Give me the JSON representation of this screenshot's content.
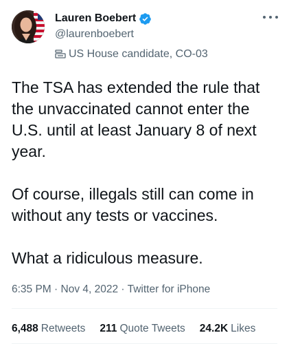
{
  "author": {
    "display_name": "Lauren Boebert",
    "handle": "@laurenboebert",
    "label": "US House candidate, CO-03",
    "verified": true
  },
  "tweet": {
    "paragraphs": [
      "The TSA has extended the rule that the unvaccinated cannot enter the U.S. until at least January 8 of next year.",
      "Of course, illegals still can come in without any tests or vaccines.",
      "What a ridiculous measure."
    ],
    "time": "6:35 PM",
    "separator": "·",
    "date": "Nov 4, 2022",
    "source": "Twitter for iPhone"
  },
  "stats": {
    "retweets_count": "6,488",
    "retweets_label": "Retweets",
    "quotes_count": "211",
    "quotes_label": "Quote Tweets",
    "likes_count": "24.2K",
    "likes_label": "Likes"
  },
  "icons": {
    "verified": "verified-badge-icon",
    "label": "government-building-icon",
    "more": "more-options-icon"
  },
  "colors": {
    "text_primary": "#0f1419",
    "text_secondary": "#536471",
    "verified_blue": "#1d9bf0",
    "divider": "#eff3f4"
  }
}
